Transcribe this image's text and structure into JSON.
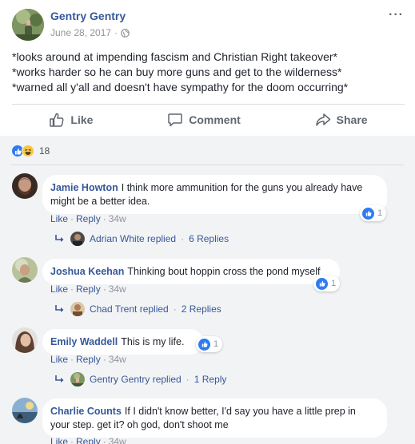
{
  "post": {
    "author": "Gentry Gentry",
    "date": "June 28, 2017",
    "more_label": "···",
    "lines": [
      "*looks around at impending fascism and Christian Right takeover*",
      "*works harder so he can buy more guns and get to the wilderness*",
      "*warned all y'all and doesn't have sympathy for the doom occurring*"
    ],
    "actions": {
      "like": "Like",
      "comment": "Comment",
      "share": "Share"
    },
    "reaction_count": "18"
  },
  "comments": [
    {
      "name": "Jamie Howton",
      "text_line1": "I think more ammunition for the guns you already have",
      "text_line2": "might be a better idea.",
      "like": "Like",
      "reply": "Reply",
      "time": "34w",
      "likes": "1",
      "replies": {
        "who": "Adrian White replied",
        "count": "6 Replies"
      }
    },
    {
      "name": "Joshua Keehan",
      "text_line1": "Thinking bout hoppin cross the pond myself",
      "like": "Like",
      "reply": "Reply",
      "time": "34w",
      "likes": "1",
      "replies": {
        "who": "Chad Trent replied",
        "count": "2 Replies"
      }
    },
    {
      "name": "Emily Waddell",
      "text_line1": "This is my life.",
      "like": "Like",
      "reply": "Reply",
      "time": "34w",
      "likes": "1",
      "replies": {
        "who": "Gentry Gentry replied",
        "count": "1 Reply"
      }
    },
    {
      "name": "Charlie Counts",
      "text_line1": "If I didn't know better, I'd say you have a little prep in",
      "text_line2": "your step. get it? oh god, don't shoot me",
      "like": "Like",
      "reply": "Reply",
      "time": "34w"
    }
  ],
  "colors": {
    "name_blue": "#365899",
    "link_blue": "#385898",
    "like_blue": "#2e7bf0",
    "bg_gray": "#f2f3f5"
  },
  "icons": [
    "globe-icon",
    "more-icon",
    "like-icon",
    "comment-icon",
    "share-icon",
    "like-reaction-icon",
    "haha-reaction-icon",
    "reply-arrow-icon"
  ]
}
